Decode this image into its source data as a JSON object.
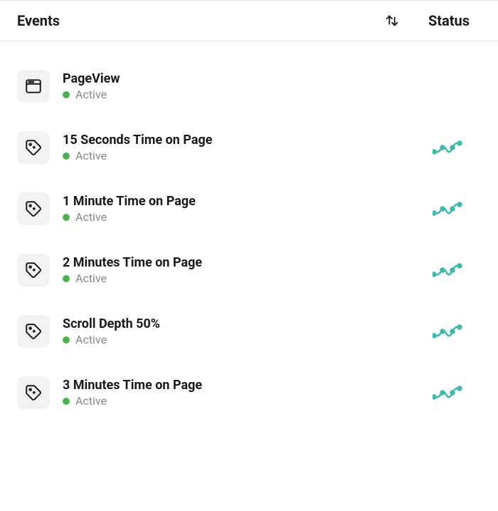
{
  "header": {
    "events_label": "Events",
    "status_label": "Status"
  },
  "rows": [
    {
      "icon": "browser",
      "title": "PageView",
      "status": "Active",
      "status_color": "#4caf50",
      "has_chart": false
    },
    {
      "icon": "tag",
      "title": "15 Seconds Time on Page",
      "status": "Active",
      "status_color": "#4caf50",
      "has_chart": true
    },
    {
      "icon": "tag",
      "title": "1 Minute Time on Page",
      "status": "Active",
      "status_color": "#4caf50",
      "has_chart": true
    },
    {
      "icon": "tag",
      "title": "2 Minutes Time on Page",
      "status": "Active",
      "status_color": "#4caf50",
      "has_chart": true
    },
    {
      "icon": "tag",
      "title": "Scroll Depth 50%",
      "status": "Active",
      "status_color": "#4caf50",
      "has_chart": true
    },
    {
      "icon": "tag",
      "title": "3 Minutes Time on Page",
      "status": "Active",
      "status_color": "#4caf50",
      "has_chart": true
    }
  ]
}
